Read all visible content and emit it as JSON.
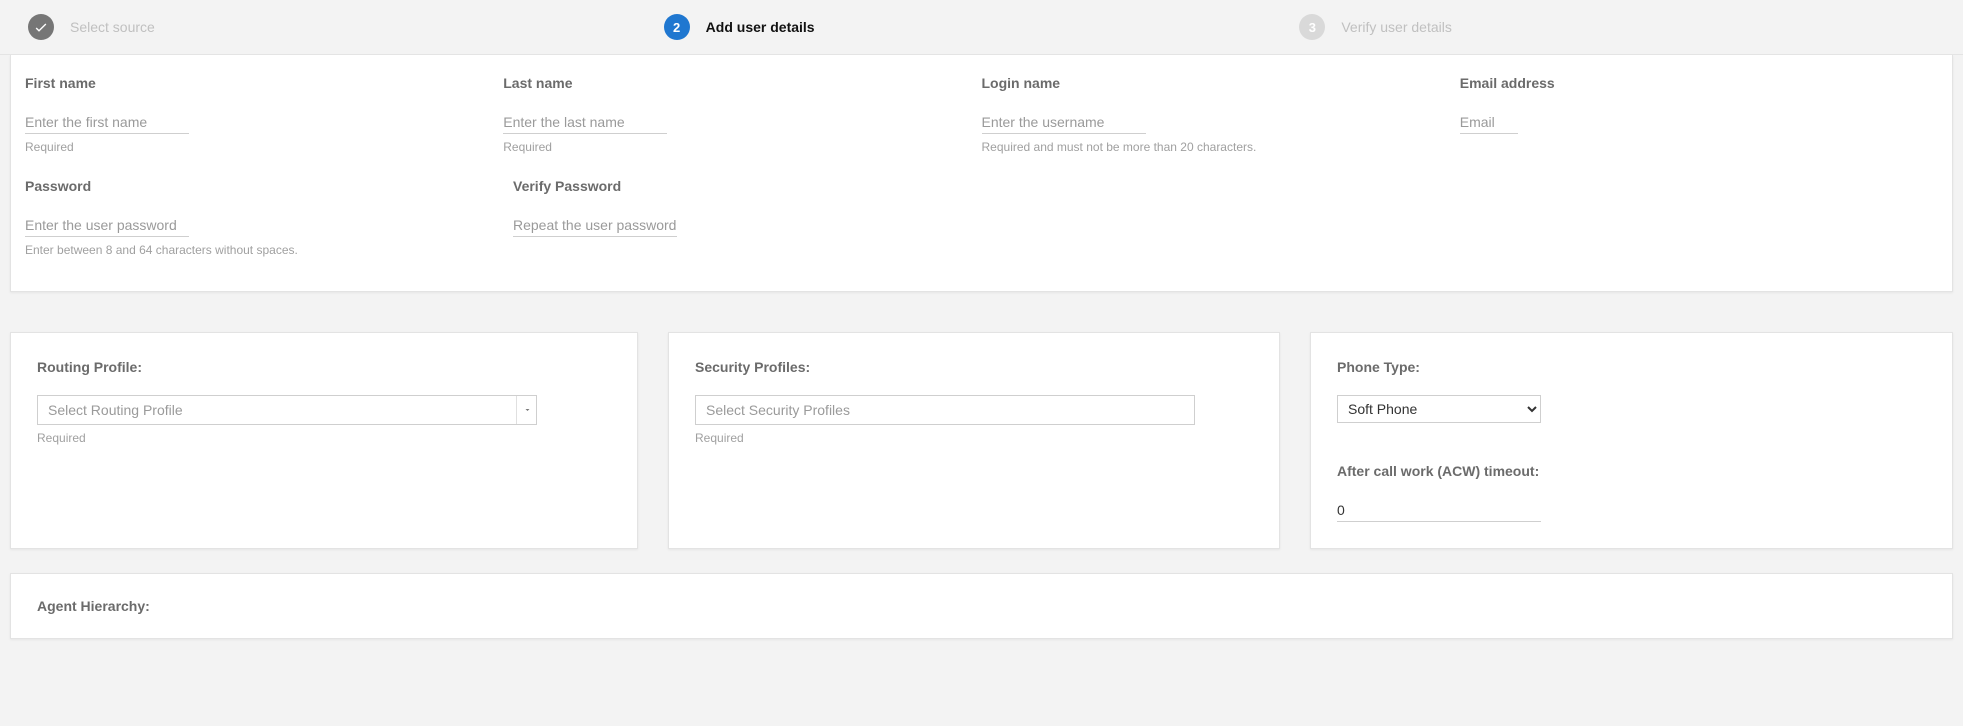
{
  "stepper": {
    "step1": {
      "label": "Select source"
    },
    "step2": {
      "num": "2",
      "label": "Add user details"
    },
    "step3": {
      "num": "3",
      "label": "Verify user details"
    }
  },
  "identity": {
    "first_name": {
      "label": "First name",
      "placeholder": "Enter the first name",
      "helper": "Required"
    },
    "last_name": {
      "label": "Last name",
      "placeholder": "Enter the last name",
      "helper": "Required"
    },
    "login_name": {
      "label": "Login name",
      "placeholder": "Enter the username",
      "helper": "Required and must not be more than 20 characters."
    },
    "email": {
      "label": "Email address",
      "placeholder": "Email"
    },
    "password": {
      "label": "Password",
      "placeholder": "Enter the user password",
      "helper": "Enter between 8 and 64 characters without spaces."
    },
    "verify_pw": {
      "label": "Verify Password",
      "placeholder": "Repeat the user password"
    }
  },
  "routing": {
    "label": "Routing Profile:",
    "placeholder": "Select Routing Profile",
    "helper": "Required"
  },
  "security": {
    "label": "Security Profiles:",
    "placeholder": "Select Security Profiles",
    "helper": "Required"
  },
  "phone": {
    "type_label": "Phone Type:",
    "type_value": "Soft Phone",
    "acw_label": "After call work (ACW) timeout:",
    "acw_value": "0"
  },
  "hierarchy": {
    "label": "Agent Hierarchy:"
  }
}
